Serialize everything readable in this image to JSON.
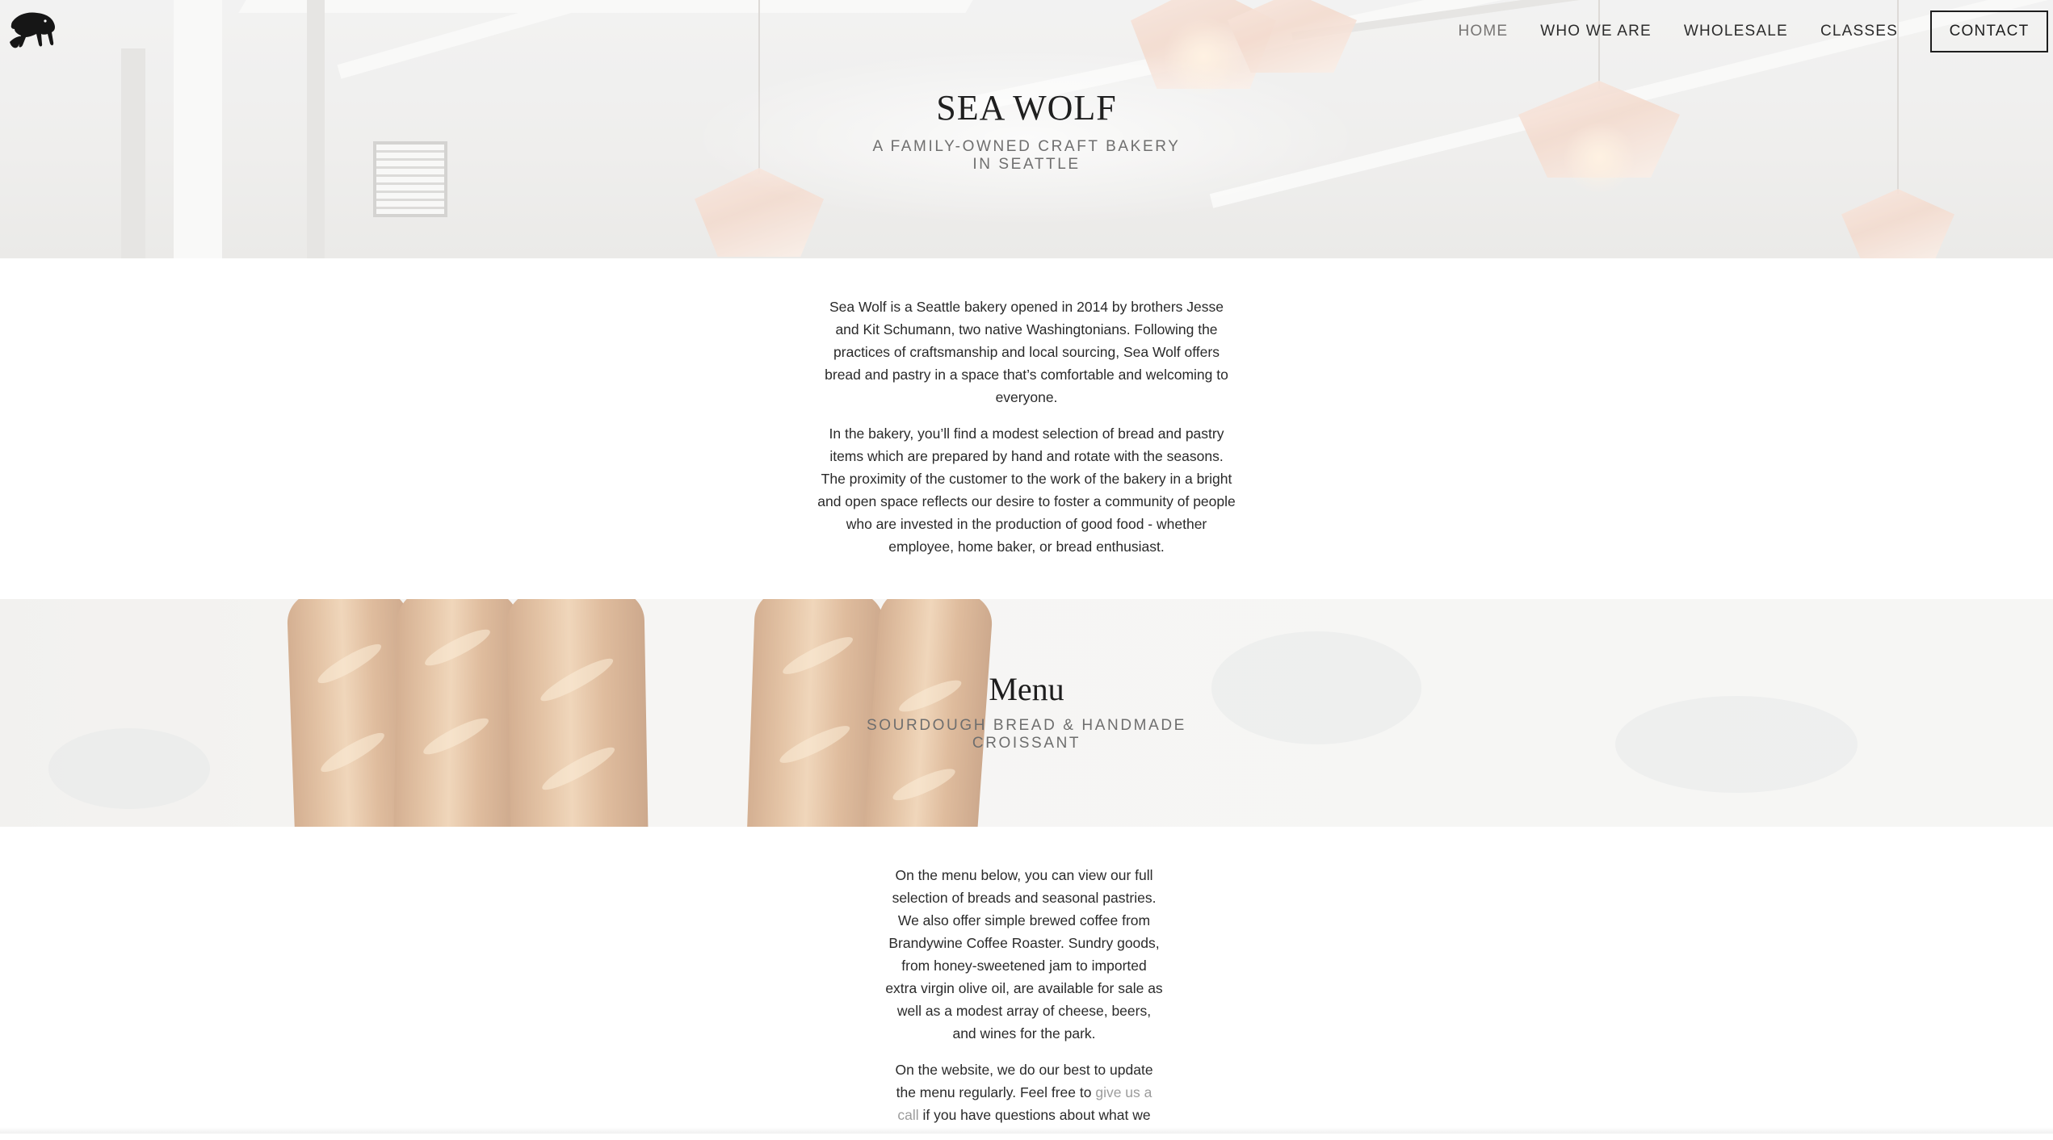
{
  "site": {
    "title": "SEA WOLF",
    "tagline": "A FAMILY-OWNED CRAFT BAKERY IN SEATTLE"
  },
  "nav": {
    "items": [
      {
        "label": "HOME",
        "active": true
      },
      {
        "label": "WHO WE ARE",
        "active": false
      },
      {
        "label": "WHOLESALE",
        "active": false
      },
      {
        "label": "CLASSES",
        "active": false
      }
    ],
    "contact_label": "CONTACT"
  },
  "about": {
    "p1": "Sea Wolf is a Seattle bakery opened in 2014 by brothers Jesse and Kit Schumann, two native Washingtonians.  Following the practices of craftsmanship and local sourcing, Sea Wolf offers bread and pastry in a space that’s comfortable and welcoming to everyone.",
    "p2": "In the bakery, you’ll find a modest selection of bread and pastry items which are prepared by hand and rotate with the seasons.  The proximity of the customer to the work of the bakery in a bright and open space reflects our desire to foster a community of people who are invested in the production of good food - whether employee,  home baker, or bread enthusiast."
  },
  "menu": {
    "title": "Menu",
    "subtitle": "SOURDOUGH BREAD & HANDMADE CROISSANT",
    "p1": "On the menu below, you can view our full selection of breads and seasonal pastries. We also offer simple brewed coffee from Brandywine Coffee Roaster. Sundry goods, from honey-sweetened jam to imported extra virgin olive oil, are available for sale as well as a modest array of cheese, beers, and wines for the park.",
    "p2_before": "On the website, we do our best to update the menu regularly. Feel free to ",
    "p2_link": "give us a call",
    "p2_after": " if you have questions about what we"
  },
  "colors": {
    "text": "#2a2a2a",
    "nav_active": "#777574",
    "link": "#9c9c9c"
  }
}
